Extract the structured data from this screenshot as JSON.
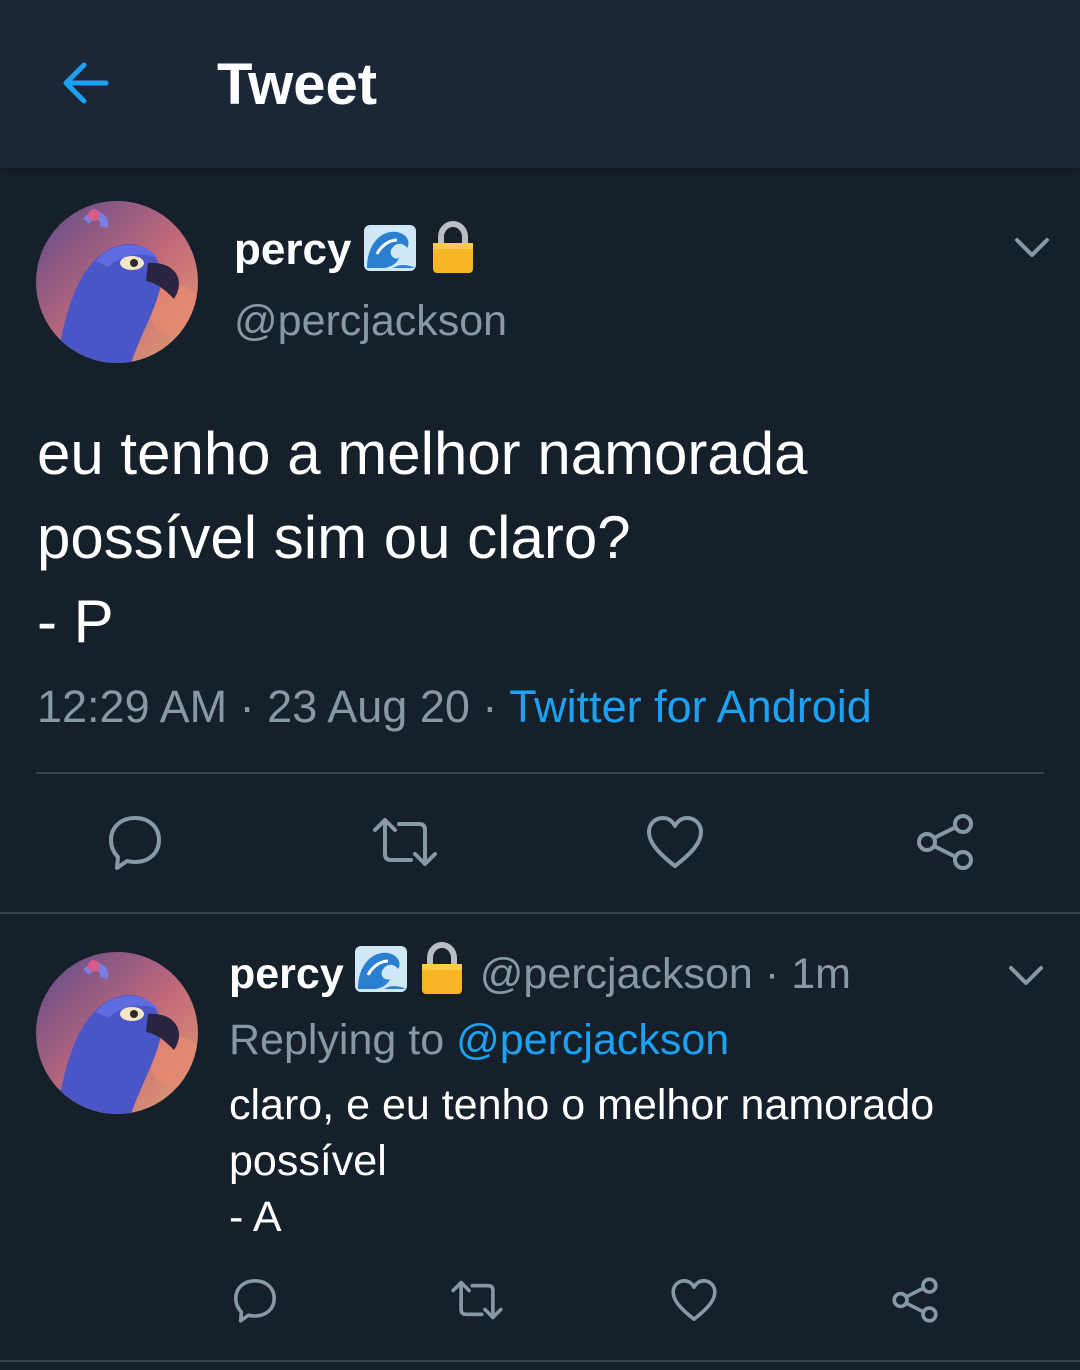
{
  "header": {
    "title": "Tweet",
    "back_icon": "arrow-left-icon"
  },
  "colors": {
    "background": "#16202b",
    "header": "#1b2736",
    "accent": "#1da1f2",
    "muted": "#8899a6",
    "divider": "#38444d"
  },
  "tweet": {
    "author_name": "percy",
    "author_emojis": [
      "🌊",
      "🔒"
    ],
    "handle": "@percjackson",
    "text_lines": [
      "eu tenho a melhor namorada",
      "possível sim ou claro?",
      "- P"
    ],
    "time": "12:29 AM",
    "date": "23 Aug 20",
    "source": "Twitter for Android",
    "separator": "·"
  },
  "reply": {
    "author_name": "percy",
    "author_emojis": [
      "🌊",
      "🔒"
    ],
    "handle": "@percjackson",
    "age": "1m",
    "replying_prefix": "Replying to",
    "replying_to": "@percjackson",
    "text_lines": [
      "claro, e eu tenho o melhor namorado",
      "possível",
      "- A"
    ]
  },
  "actions": [
    "reply-icon",
    "retweet-icon",
    "like-icon",
    "share-icon"
  ]
}
